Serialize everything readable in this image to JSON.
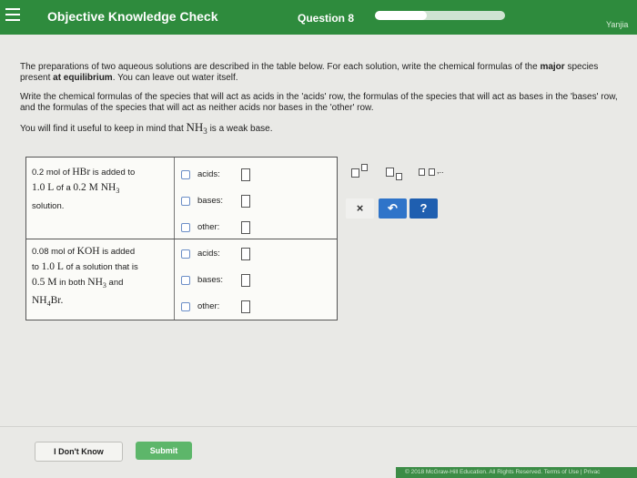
{
  "header": {
    "title": "Objective Knowledge Check",
    "question": "Question 8",
    "progress": 0.4,
    "user": "Yanjia"
  },
  "instructions": {
    "p1_a": "The preparations of two aqueous solutions are described in the table below. For each solution, write the chemical formulas of the ",
    "p1_b": "major",
    "p1_c": " species present ",
    "p1_d": "at equilibrium",
    "p1_e": ". You can leave out water itself.",
    "p2": "Write the chemical formulas of the species that will act as acids in the 'acids' row, the formulas of the species that will act as bases in the 'bases' row, and the formulas of the species that will act as neither acids nor bases in the 'other' row.",
    "p3_a": "You will find it useful to keep in mind that ",
    "p3_formula": "NH",
    "p3_sub": "3",
    "p3_b": " is a weak base."
  },
  "table": {
    "row1": {
      "l1a": "0.2 mol of ",
      "l1f": "HBr",
      "l1b": " is added to",
      "l2a": "1.0 L",
      "l2b": " of a ",
      "l2c": "0.2 M NH",
      "l2sub": "3",
      "l3": "solution."
    },
    "row2": {
      "l1a": "0.08 mol of ",
      "l1f": "KOH",
      "l1b": " is added",
      "l2a": "to ",
      "l2b": "1.0 L",
      "l2c": " of a solution that is",
      "l3a": "0.5 M",
      "l3b": " in both ",
      "l3c": "NH",
      "l3sub": "3",
      "l3d": " and",
      "l4a": "NH",
      "l4sub": "4",
      "l4b": "Br."
    },
    "labels": {
      "acids": "acids:",
      "bases": "bases:",
      "other": "other:"
    }
  },
  "toolbar": {
    "clear": "×",
    "undo": "↶",
    "help": "?"
  },
  "footer": {
    "dont_know": "I Don't Know",
    "submit": "Submit",
    "copyright": "© 2018 McGraw-Hill Education. All Rights Reserved.   Terms of Use  |  Privac"
  }
}
